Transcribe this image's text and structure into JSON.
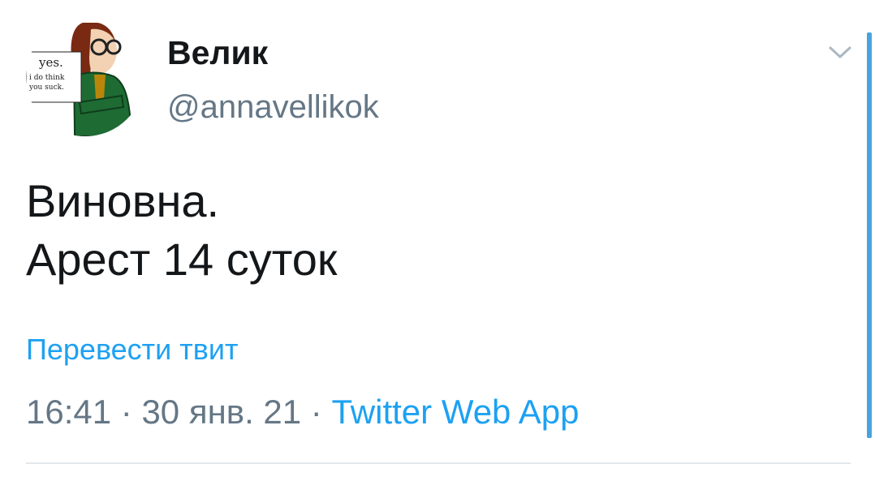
{
  "author": {
    "display_name": "Велик",
    "handle": "@annavellikok",
    "avatar_text": [
      "yes.",
      "i do think",
      "you suck."
    ]
  },
  "tweet": {
    "lines": [
      "Виновна.",
      "Арест 14 суток"
    ]
  },
  "translate": {
    "label": "Перевести твит"
  },
  "meta": {
    "time": "16:41",
    "separator": " · ",
    "date": "30 янв. 21",
    "source": "Twitter Web App"
  },
  "icons": {
    "caret": "chevron-down-icon"
  },
  "colors": {
    "text": "#14171a",
    "secondary": "#657786",
    "link": "#1da1f2",
    "divider": "#e1e8ed",
    "avatar_coat": "#1e6b34",
    "avatar_hair": "#7a2a12"
  }
}
